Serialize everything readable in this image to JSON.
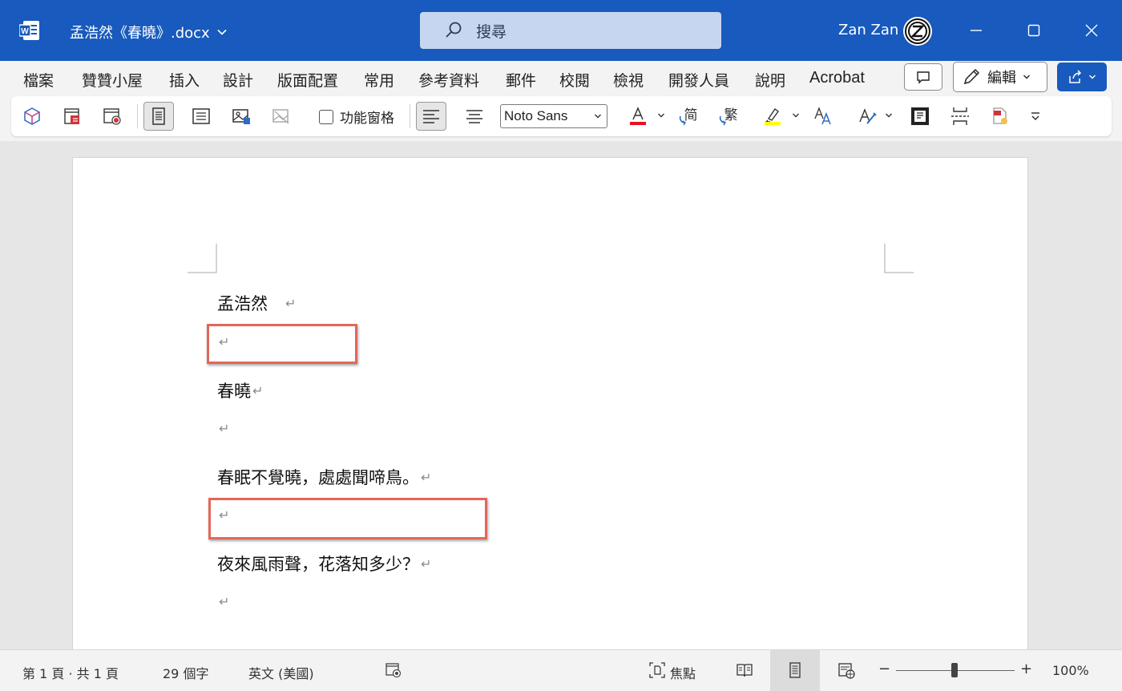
{
  "titlebar": {
    "doc_title": "孟浩然《春曉》.docx",
    "search_placeholder": "搜尋",
    "user_name": "Zan Zan",
    "accent": "#185abd"
  },
  "menu": {
    "items": [
      "檔案",
      "贊贊小屋",
      "插入",
      "設計",
      "版面配置",
      "常用",
      "參考資料",
      "郵件",
      "校閱",
      "檢視",
      "開發人員",
      "說明",
      "Acrobat"
    ],
    "edit_label": "編輯"
  },
  "ribbon": {
    "pane_label": "功能窗格",
    "font_name": "Noto Sans",
    "simplified_label": "简",
    "traditional_label": "繁",
    "font_color": "#e81123",
    "highlight_color": "#ffff00"
  },
  "document": {
    "paragraphs": [
      {
        "text": "孟浩然",
        "mark": "↵"
      },
      {
        "text": "",
        "mark": "↵"
      },
      {
        "text": "春曉",
        "mark": "↵"
      },
      {
        "text": "",
        "mark": "↵"
      },
      {
        "text": "春眠不覺曉，處處聞啼鳥。",
        "mark": "↵"
      },
      {
        "text": "",
        "mark": "↵"
      },
      {
        "text": "夜來風雨聲，花落知多少？",
        "mark": "↵"
      },
      {
        "text": "",
        "mark": "↵"
      }
    ],
    "highlight_color": "#e2675a"
  },
  "status": {
    "page": "第 1 頁 · 共 1 頁",
    "words": "29 個字",
    "language": "英文 (美國)",
    "focus": "焦點",
    "zoom": "100%",
    "zoom_minus": "−",
    "zoom_plus": "+"
  }
}
